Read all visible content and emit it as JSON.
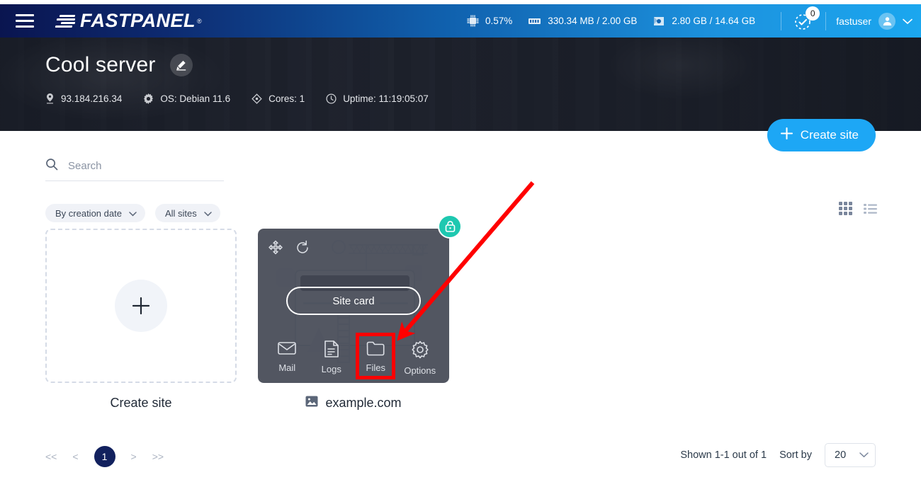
{
  "topbar": {
    "menu_icon": "hamburger-icon",
    "brand": "FASTPANEL",
    "brand_reg": "®",
    "stats": [
      {
        "icon": "cpu-icon",
        "value": "0.57%"
      },
      {
        "icon": "ram-icon",
        "value": "330.34 MB / 2.00 GB"
      },
      {
        "icon": "disk-icon",
        "value": "2.80 GB / 14.64 GB"
      }
    ],
    "notifications": {
      "icon": "check-circle-icon",
      "count": "0"
    },
    "user": {
      "name": "fastuser",
      "avatar_icon": "user-avatar-icon",
      "caret_icon": "chevron-down-icon"
    }
  },
  "hero": {
    "server_name": "Cool server",
    "edit_icon": "pencil-icon",
    "meta": [
      {
        "icon": "location-pin-icon",
        "text": "93.184.216.34"
      },
      {
        "icon": "gear-icon",
        "text": "OS: Debian 11.6"
      },
      {
        "icon": "diamond-icon",
        "text": "Cores: 1"
      },
      {
        "icon": "clock-icon",
        "text": "Uptime: 11:19:05:07"
      }
    ]
  },
  "actions": {
    "create_site_top": "Create site",
    "plus_icon": "plus-icon"
  },
  "toolbar": {
    "search_placeholder": "Search",
    "search_value": "",
    "search_icon": "search-icon",
    "filters": [
      {
        "label": "By creation date",
        "icon": "chevron-down-icon"
      },
      {
        "label": "All sites",
        "icon": "chevron-down-icon"
      }
    ],
    "views": [
      {
        "name": "grid-view",
        "icon": "grid-icon",
        "active": true
      },
      {
        "name": "list-view",
        "icon": "list-icon",
        "active": false
      }
    ]
  },
  "cards": {
    "create": {
      "caption": "Create site",
      "plus_icon": "plus-icon"
    },
    "site": {
      "name": "example.com",
      "thumb_icon": "image-icon",
      "ssl_badge_icon": "lock-icon",
      "overlay_icons": [
        {
          "name": "move-icon"
        },
        {
          "name": "reload-icon"
        }
      ],
      "site_card_button": "Site card",
      "actions": [
        {
          "label": "Mail",
          "icon": "envelope-icon"
        },
        {
          "label": "Logs",
          "icon": "document-icon"
        },
        {
          "label": "Files",
          "icon": "folder-icon"
        },
        {
          "label": "Options",
          "icon": "gear-icon"
        }
      ]
    }
  },
  "annotations": {
    "highlight_target": "Files",
    "highlight_color": "#ff0000",
    "arrow_color": "#ff0000"
  },
  "footer": {
    "pagination": {
      "first": "<<",
      "prev": "<",
      "current": "1",
      "next": ">",
      "last": ">>"
    },
    "shown": "Shown 1-1 out of 1",
    "sort_label": "Sort by",
    "page_size": "20",
    "page_size_icon": "chevron-down-icon"
  },
  "colors": {
    "brand_blue": "#1da7f5",
    "header_navy": "#0a1550",
    "ssl_teal": "#1ec8b0",
    "pager_active": "#12215e",
    "annotation_red": "#ff0000"
  }
}
